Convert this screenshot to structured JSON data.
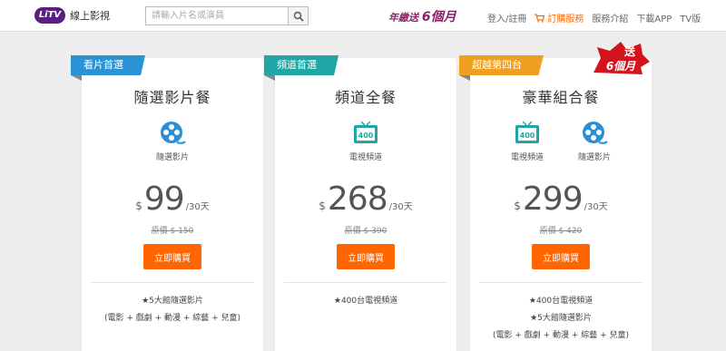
{
  "header": {
    "logo_badge": "LiTV",
    "logo_text": "線上影視",
    "search_placeholder": "請輸入片名或演員",
    "promo_prefix": "年繳送",
    "promo_big": "6個月",
    "nav": {
      "login": "登入/註冊",
      "subscribe": "訂購服務",
      "service_intro": "服務介紹",
      "download_app": "下載APP",
      "tv": "TV版"
    }
  },
  "colors": {
    "ribbon_blue": "#2a93d5",
    "ribbon_teal": "#1fa6a6",
    "ribbon_orange": "#f0a020",
    "buy_orange": "#ff6600",
    "brand_purple": "#5a1e82"
  },
  "plans": [
    {
      "ribbon": "看片首選",
      "title": "隨選影片餐",
      "features": [
        {
          "icon": "film-reel-icon",
          "label": "隨選影片"
        }
      ],
      "currency": "$",
      "price": "99",
      "unit": "/30天",
      "original": "原價 $ 150",
      "buy": "立即購買",
      "desc": [
        "★5大館隨選影片",
        "(電影 + 戲劇 + 動漫 + 綜藝 + 兒童)"
      ]
    },
    {
      "ribbon": "頻道首選",
      "title": "頻道全餐",
      "features": [
        {
          "icon": "tv-400-icon",
          "label": "電視頻道"
        }
      ],
      "currency": "$",
      "price": "268",
      "unit": "/30天",
      "original": "原價 $ 390",
      "buy": "立即購買",
      "desc": [
        "★400台電視頻道"
      ]
    },
    {
      "ribbon": "超越第四台",
      "title": "豪華組合餐",
      "features": [
        {
          "icon": "tv-400-icon",
          "label": "電視頻道"
        },
        {
          "icon": "film-reel-icon",
          "label": "隨選影片"
        }
      ],
      "currency": "$",
      "price": "299",
      "unit": "/30天",
      "original": "原價 $ 420",
      "buy": "立即購買",
      "desc": [
        "★400台電視頻道",
        "★5大館隨選影片",
        "(電影 + 戲劇 + 動漫 + 綜藝 + 兒童)"
      ]
    }
  ],
  "bonus_badge": {
    "line1": "送",
    "line2": "6個月"
  }
}
